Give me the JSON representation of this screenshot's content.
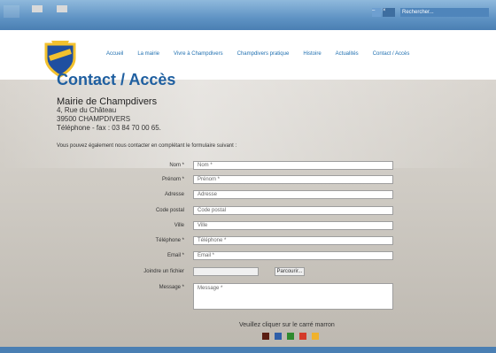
{
  "browser": {
    "tab_favicon_text": "",
    "window_controls": [
      "–",
      "×"
    ],
    "search_text": "Rechercher..."
  },
  "site": {
    "nav": [
      "Accueil",
      "La mairie",
      "Vivre à Champdivers",
      "Champdivers pratique",
      "Histoire",
      "Actualités",
      "Contact / Accès"
    ],
    "page_title": "Contact / Accès",
    "address": {
      "name": "Mairie de Champdivers",
      "line1": "4, Rue du Château",
      "line2": "39500 CHAMPDIVERS",
      "line3": "Téléphone - fax : 03 84 70 00 65."
    },
    "intro": "Vous pouvez également nous contacter en complétant le formulaire suivant :"
  },
  "form": {
    "fields": [
      {
        "label": "Nom *",
        "placeholder": "Nom *"
      },
      {
        "label": "Prénom *",
        "placeholder": "Prénom *"
      },
      {
        "label": "Adresse",
        "placeholder": "Adresse"
      },
      {
        "label": "Code postal",
        "placeholder": "Code postal"
      },
      {
        "label": "Ville",
        "placeholder": "Ville"
      },
      {
        "label": "Téléphone *",
        "placeholder": "Téléphone *"
      },
      {
        "label": "Email *",
        "placeholder": "Email *"
      }
    ],
    "file_label": "Joindre un fichier",
    "file_button": "Parcourir...",
    "message_label": "Message *",
    "message_placeholder": "Message *",
    "captcha_text": "Veuillez cliquer sur le carré marron",
    "captcha_colors": [
      "#5a1d12",
      "#2f5fa8",
      "#2f8a2f",
      "#d43a2a",
      "#f0b22e"
    ]
  }
}
